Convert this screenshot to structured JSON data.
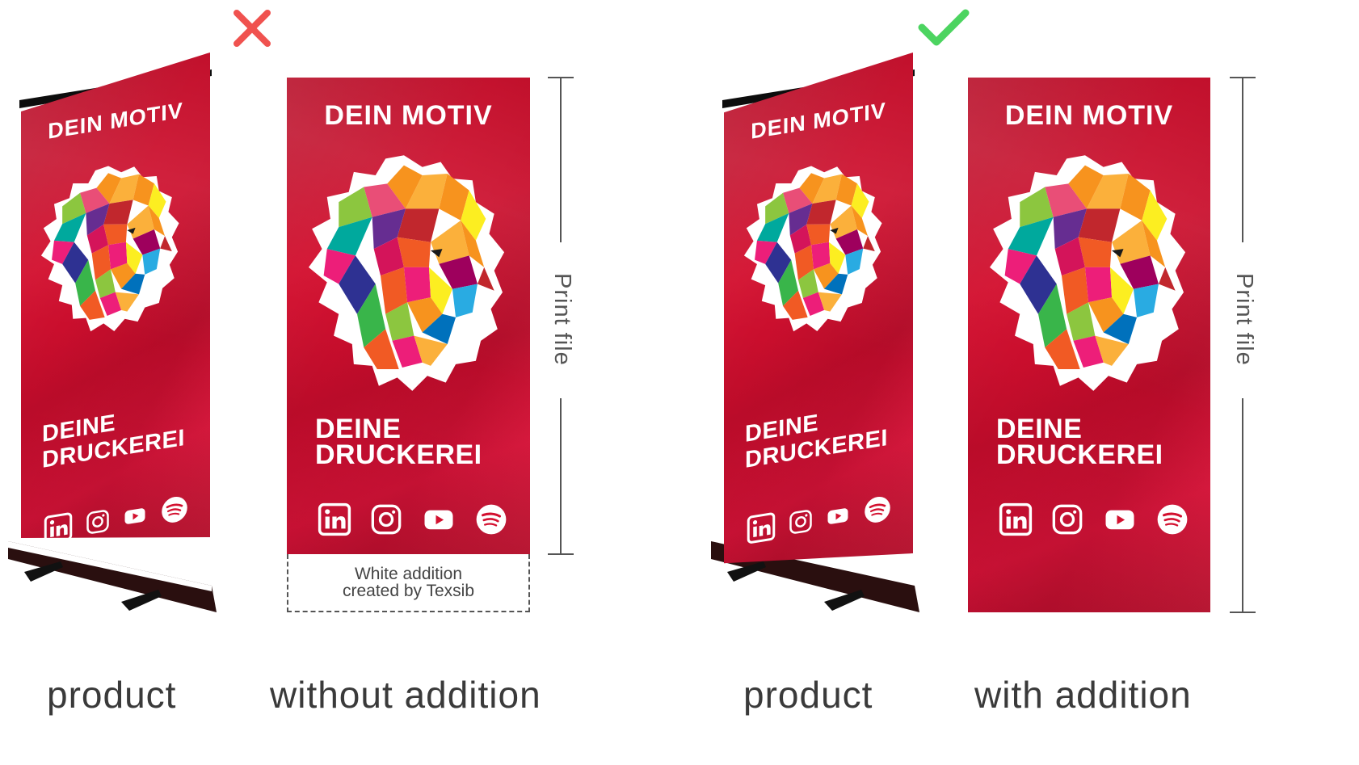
{
  "banner": {
    "headline": "DEIN MOTIV",
    "line1": "DEINE",
    "line2": "DRUCKEREI",
    "social_icons": [
      "linkedin-icon",
      "instagram-icon",
      "youtube-icon",
      "spotify-icon"
    ]
  },
  "marks": {
    "wrong": "✕",
    "right": "✓",
    "wrong_color": "#f0524f",
    "right_color": "#4cd460"
  },
  "dimension_label": "Print file",
  "addition_note": {
    "line1": "White addition",
    "line2": "created by Texsib"
  },
  "captions": {
    "product_left": "product",
    "without": "without addition",
    "product_right": "product",
    "with": "with addition"
  },
  "colors": {
    "banner_red": "#d3102f",
    "stand_dark": "#1a0a0a"
  }
}
